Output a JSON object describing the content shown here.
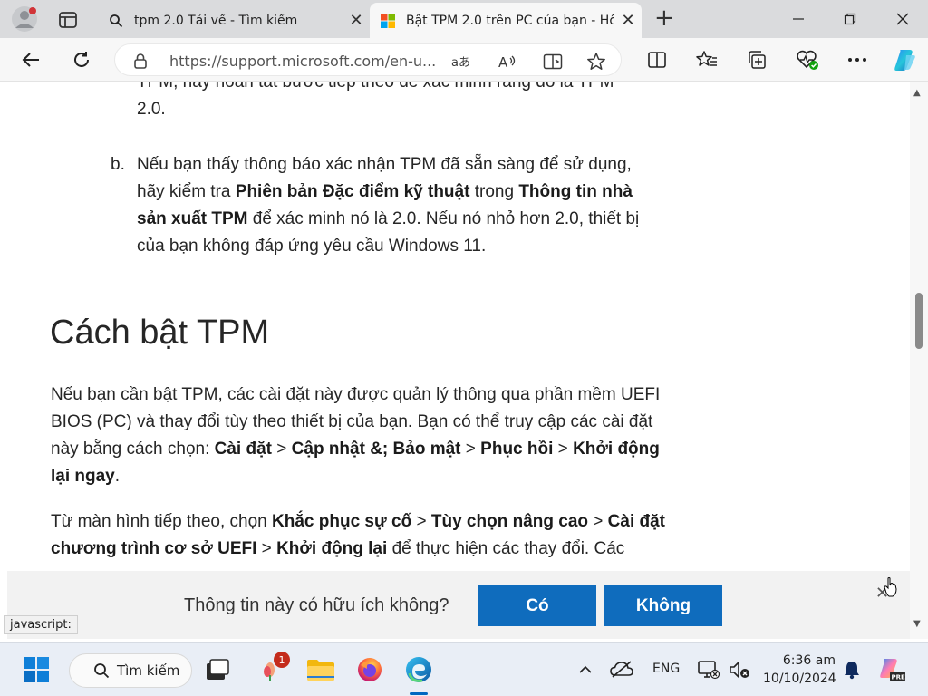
{
  "browser": {
    "tabs": [
      {
        "title": "tpm 2.0 Tải về - Tìm kiếm",
        "close": "✕"
      },
      {
        "title": "Bật TPM 2.0 trên PC của bạn - Hỗ",
        "close": "✕"
      }
    ],
    "new_tab": "+",
    "url": "https://support.microsoft.com/en-u..."
  },
  "article": {
    "cut_line_1": "TPM, hãy hoàn tất bước tiếp theo để xác minh rằng đó là TPM",
    "cut_line_2": "2.0.",
    "item_b": {
      "marker": "b.",
      "t1": "Nếu bạn thấy thông báo xác nhận TPM đã sẵn sàng để sử dụng, hãy kiểm tra ",
      "b1": "Phiên bản Đặc điểm kỹ thuật",
      "t2": " trong ",
      "b2": "Thông tin nhà sản xuất TPM",
      "t3": " để xác minh nó là 2.0. Nếu nó nhỏ hơn 2.0, thiết bị của bạn không đáp ứng yêu cầu Windows 11."
    },
    "heading": "Cách bật TPM",
    "para1": {
      "t1": "Nếu bạn cần bật TPM, các cài đặt này được quản lý thông qua phần mềm UEFI BIOS (PC) và thay đổi tùy theo thiết bị của bạn. Bạn có thể truy cập các cài đặt này bằng cách chọn: ",
      "b1": "Cài đặt",
      "sep1": " > ",
      "b2": "Cập nhật &; Bảo mật",
      "sep2": " > ",
      "b3": "Phục hồi",
      "sep3": " > ",
      "b4": "Khởi động lại ngay",
      "end": "."
    },
    "para2": {
      "t1": "Từ màn hình tiếp theo, chọn ",
      "b1": "Khắc phục sự cố",
      "sep1": " > ",
      "b2": "Tùy chọn nâng cao",
      "sep2": " > ",
      "b3": "Cài đặt chương trình cơ sở UEFI",
      "sep3": " > ",
      "b4": "Khởi động lại",
      "t2": " để thực hiện các thay đổi. Các"
    }
  },
  "feedback": {
    "question": "Thông tin này có hữu ích không?",
    "yes": "Có",
    "no": "Không",
    "close": "✕"
  },
  "status_text": "javascript:",
  "taskbar": {
    "search_label": "Tìm kiếm",
    "notification_count": "1",
    "language": "ENG",
    "time": "6:36 am",
    "date": "10/10/2024"
  },
  "colors": {
    "accent": "#0f6cbd",
    "tabstrip": "#dadbdd",
    "taskbar": "#e9eef6"
  }
}
